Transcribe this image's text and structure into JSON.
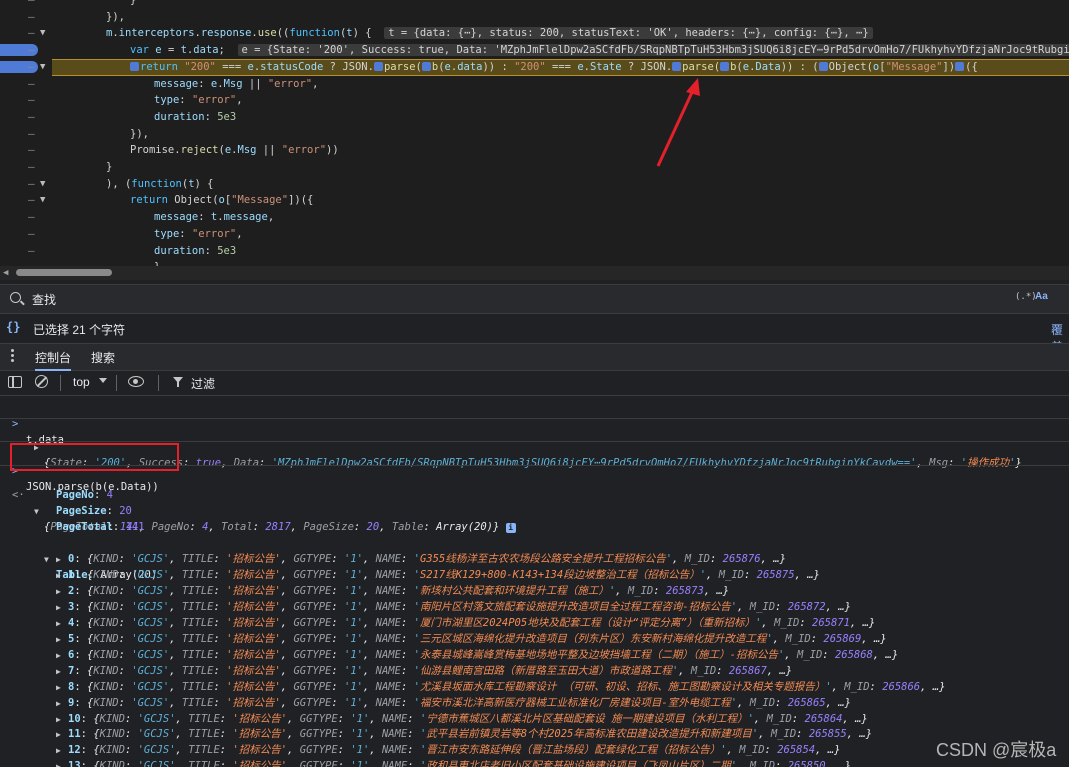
{
  "editor": {
    "lines": [
      {
        "html": "<span>}</span>",
        "indent": 3,
        "arrow": false,
        "bp": false
      },
      {
        "html": "<span>}),</span>",
        "indent": 2,
        "arrow": false,
        "bp": false
      },
      {
        "html": "<span class='prop'>m</span>.<span class='prop'>interceptors</span>.<span class='prop'>response</span>.<span class='fn'>use</span>((<span class='kw'>function</span>(<span class='prop'>t</span>) {  <span class='inline-val'>t = {data: {⋯}, status: 200, statusText: 'OK', headers: {⋯}, config: {⋯}, ⋯}</span>",
        "indent": 2,
        "arrow": true,
        "bp": false
      },
      {
        "html": "<span class='kw'>var</span> <span class='prop'>e</span> = <span class='prop'>t</span>.<span class='prop'>data</span>;  <span class='inline-val'>e = {State: '200', Success: true, Data: 'MZphJmFlelDpw2aSCfdFb/SRqpNBTpTuH53Hbm3jSUQ6i8jcEY⋯9rPd5drvOmHo7/FUkhyhvYDfzjaNrJoc9tRubginYkCavd</span>",
        "indent": 3,
        "arrow": false,
        "bp": true
      },
      {
        "html": "<span class='chip'></span><span class='kw'>return</span> <span class='str'>\"200\"</span> === <span class='prop'>e</span>.<span class='prop'>statusCode</span> ? JSON.<span class='chip'></span><span class='fn'>parse</span>(<span class='chip'></span><span class='fn'>b</span>(<span class='prop'>e</span>.<span class='prop'>data</span>)) : <span class='str'>\"200\"</span> === <span class='prop'>e</span>.<span class='prop'>State</span> ? JSON.<span class='chip'></span><span class='fn'>parse</span>(<span class='chip'></span><span class='fn'>b</span>(<span class='prop'>e</span>.<span class='prop'>Data</span>)) : (<span class='chip'></span>Object(<span class='prop'>o</span>[<span class='str'>\"Message\"</span>])<span class='chip'></span>({",
        "indent": 3,
        "arrow": true,
        "bp": true
      },
      {
        "html": "<span class='prop'>message</span>: <span class='prop'>e</span>.<span class='prop'>Msg</span> || <span class='str'>\"error\"</span>,",
        "indent": 4,
        "arrow": false,
        "bp": false
      },
      {
        "html": "<span class='prop'>type</span>: <span class='str'>\"error\"</span>,",
        "indent": 4,
        "arrow": false,
        "bp": false
      },
      {
        "html": "<span class='prop'>duration</span>: <span class='num'>5e3</span>",
        "indent": 4,
        "arrow": false,
        "bp": false
      },
      {
        "html": "}),",
        "indent": 3,
        "arrow": false,
        "bp": false
      },
      {
        "html": "Promise.<span class='fn'>reject</span>(<span class='prop'>e</span>.<span class='prop'>Msg</span> || <span class='str'>\"error\"</span>))",
        "indent": 3,
        "arrow": false,
        "bp": false
      },
      {
        "html": "}",
        "indent": 2,
        "arrow": false,
        "bp": false
      },
      {
        "html": "), (<span class='kw'>function</span>(<span class='prop'>t</span>) {",
        "indent": 2,
        "arrow": true,
        "bp": false
      },
      {
        "html": "<span class='kw'>return</span> Object(<span class='prop'>o</span>[<span class='str'>\"Message\"</span>])({",
        "indent": 3,
        "arrow": true,
        "bp": false
      },
      {
        "html": "<span class='prop'>message</span>: <span class='prop'>t</span>.<span class='prop'>message</span>,",
        "indent": 4,
        "arrow": false,
        "bp": false
      },
      {
        "html": "<span class='prop'>type</span>: <span class='str'>\"error\"</span>,",
        "indent": 4,
        "arrow": false,
        "bp": false
      },
      {
        "html": "<span class='prop'>duration</span>: <span class='num'>5e3</span>",
        "indent": 4,
        "arrow": false,
        "bp": false
      },
      {
        "html": "}",
        "indent": 4,
        "arrow": false,
        "bp": false
      }
    ]
  },
  "search": {
    "placeholder": "查找",
    "regex_label": "(.*)",
    "case_label": "Aa"
  },
  "selection": {
    "text": "已选择 21 个字符",
    "coverage_link": "覆盖"
  },
  "drawer": {
    "tabs": [
      "控制台",
      "搜索"
    ]
  },
  "toolbar": {
    "context": "top",
    "filter_placeholder": "过滤"
  },
  "console": {
    "input1": "t.data",
    "output1_html": "<span class='italic'>{<span class='key'>State</span>: <span class='sval'>'200'</span>, <span class='key'>Success</span>: <span class='bool'>true</span>, <span class='key'>Data</span>: <span class='sval'>'MZphJmFlelDpw2aSCfdFb/SRqpNBTpTuH53Hbm3jSUQ6i8jcEY⋯9rPd5drvOmHo7/FUkhyhvYDfzjaNrJoc9tRubginYkCavdw=='</span>, <span class='key'>Msg</span>: <span class='sval'>'</span><span class='cjk'>操作成功</span><span class='sval'>'</span>}</span>",
    "input2": "JSON.parse(b(e.Data))",
    "output2_html": "<span class='italic'>{<span class='key'>PageTotal</span>: <span class='nval'>141</span>, <span class='key'>PageNo</span>: <span class='nval'>4</span>, <span class='key'>Total</span>: <span class='nval'>2817</span>, <span class='key'>PageSize</span>: <span class='nval'>20</span>, <span class='key'>Table</span>: Array(20)}</span> <span class='info-badge'>i</span>",
    "props": [
      {
        "key": "PageNo",
        "value": "4"
      },
      {
        "key": "PageSize",
        "value": "20"
      },
      {
        "key": "PageTotal",
        "value": "141"
      }
    ],
    "table_label": "Table",
    "table_type": "Array(20)",
    "rows": [
      {
        "idx": "0",
        "name": "G355线杨洋至古农农场段公路安全提升工程招标公告",
        "mid": "265876"
      },
      {
        "idx": "1",
        "name": "S217线K129+800-K143+134段边坡整治工程（招标公告）",
        "mid": "265875"
      },
      {
        "idx": "2",
        "name": "新垓村公共配套和环境提升工程（施工）",
        "mid": "265873"
      },
      {
        "idx": "3",
        "name": "南阳片区村落文旅配套设施提升改造项目全过程工程咨询-招标公告",
        "mid": "265872"
      },
      {
        "idx": "4",
        "name": "厦门市湖里区2024P05地块及配套工程（设计“评定分离”）（重新招标）",
        "mid": "265871"
      },
      {
        "idx": "5",
        "name": "三元区城区海绵化提升改造项目（列东片区）东安新村海绵化提升改造工程",
        "mid": "265869"
      },
      {
        "idx": "6",
        "name": "永泰县城峰嵩峰赏梅基地场地平整及边坡挡墙工程（二期）（施工）-招标公告",
        "mid": "265868"
      },
      {
        "idx": "7",
        "name": "仙游县鲤南宫田路（新厝路至玉田大道）市政道路工程",
        "mid": "265867"
      },
      {
        "idx": "8",
        "name": "尤溪县坂面水库工程勘察设计 （可研、初设、招标、施工图勘察设计及相关专题报告）",
        "mid": "265866"
      },
      {
        "idx": "9",
        "name": "福安市溪北洋高新医疗器械工业标准化厂房建设项目-室外电缆工程",
        "mid": "265865"
      },
      {
        "idx": "10",
        "name": "宁德市蕉城区八都溪北片区基础配套设 施一期建设项目（水利工程）",
        "mid": "265864"
      },
      {
        "idx": "11",
        "name": "武平县岩前镇灵岩等8个村2025年高标准农田建设改造提升和新建项目",
        "mid": "265855"
      },
      {
        "idx": "12",
        "name": "晋江市安东路延伸段（晋江盐场段）配套绿化工程（招标公告）",
        "mid": "265854"
      },
      {
        "idx": "13",
        "name": "政和县東北店老旧小区配套基础设施建设项目（飞凤山片区）二期",
        "mid": "265850"
      }
    ],
    "row_kind": "'GCJS'",
    "row_title": "'招标公告'",
    "row_ggtype": "'1'"
  },
  "watermark": "CSDN @宸极a"
}
